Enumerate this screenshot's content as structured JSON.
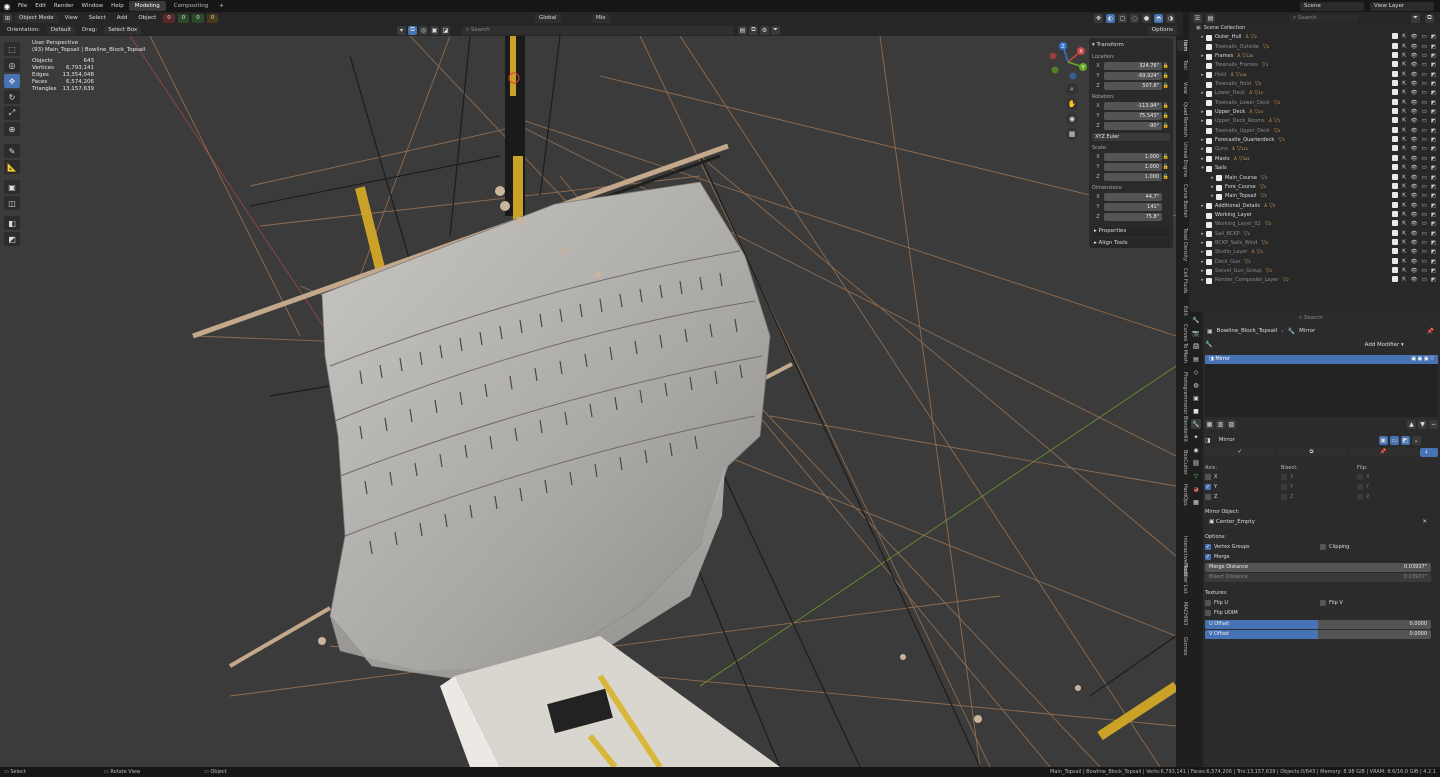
{
  "menu": [
    "File",
    "Edit",
    "Render",
    "Window",
    "Help"
  ],
  "workspaces": [
    "Modeling",
    "Compositing"
  ],
  "scene": {
    "label": "Scene",
    "view_layer": "View Layer"
  },
  "header": {
    "mode": "Object Mode",
    "menus": [
      "View",
      "Select",
      "Add",
      "Object"
    ],
    "counters": [
      "0",
      "0",
      "0",
      "0"
    ],
    "orientation_label": "Orientation:",
    "orientation": "Default",
    "drag_label": "Drag:",
    "drag": "Select Box",
    "transform_orientation": "Global",
    "pivot": "Mix",
    "search_placeholder": "Search",
    "options": "Options"
  },
  "overlay": {
    "view": "User Perspective",
    "context": "(93) Main_Topsail | Bowline_Block_Topsail",
    "stats": [
      {
        "k": "Objects",
        "v": "643"
      },
      {
        "k": "Vertices",
        "v": "6,793,141"
      },
      {
        "k": "Edges",
        "v": "13,354,048"
      },
      {
        "k": "Faces",
        "v": "6,574,206"
      },
      {
        "k": "Triangles",
        "v": "13,157,639"
      }
    ]
  },
  "gizmo": {
    "x": "X",
    "y": "Y",
    "z": "Z"
  },
  "npanel": {
    "title": "Transform",
    "location_label": "Location:",
    "location": [
      {
        "a": "X",
        "v": "324.76\""
      },
      {
        "a": "Y",
        "v": "-69.924\""
      },
      {
        "a": "Z",
        "v": "507.8\""
      }
    ],
    "rotation_label": "Rotation:",
    "rotation": [
      {
        "a": "X",
        "v": "-113.94°"
      },
      {
        "a": "Y",
        "v": "75.543°"
      },
      {
        "a": "Z",
        "v": "-90°"
      }
    ],
    "rotation_mode": "XYZ Euler",
    "scale_label": "Scale:",
    "scale": [
      {
        "a": "X",
        "v": "1.000"
      },
      {
        "a": "Y",
        "v": "1.000"
      },
      {
        "a": "Z",
        "v": "1.000"
      }
    ],
    "dimensions_label": "Dimensions:",
    "dimensions": [
      {
        "a": "X",
        "v": "44.7\""
      },
      {
        "a": "Y",
        "v": "141\""
      },
      {
        "a": "Z",
        "v": "75.8\""
      }
    ],
    "properties": "Properties",
    "align_tools": "Align Tools"
  },
  "side_tabs": [
    "Item",
    "Tool",
    "View",
    "Quad Remesh",
    "Unreal Engine",
    "Curve Basher",
    "Texel Density",
    "Cell Fluids",
    "Edit",
    "Curves To Mesh",
    "Photogrammetor",
    "BlenderKit",
    "BoxCutter",
    "HardOps",
    "Interactive Tools",
    "Modifier List",
    "MACHIN3",
    "Gizmos"
  ],
  "outliner": {
    "search": "Search",
    "root": "Scene Collection",
    "items": [
      {
        "name": "Outer_Hull",
        "mods": "⅄ ▽₂",
        "dim": false,
        "tri": "▸",
        "indent": 0
      },
      {
        "name": "Treenails_Outside",
        "mods": "▽₂",
        "dim": true,
        "tri": "",
        "indent": 0
      },
      {
        "name": "Frames",
        "mods": "⅄ ▽₁₂₆",
        "dim": false,
        "tri": "▸",
        "indent": 0
      },
      {
        "name": "Treenails_Frames",
        "mods": "▽₂",
        "dim": true,
        "tri": "",
        "indent": 0
      },
      {
        "name": "Hold",
        "mods": "⅄ ▽₁₁₆",
        "dim": true,
        "tri": "▸",
        "indent": 0
      },
      {
        "name": "Treenails_Hold",
        "mods": "▽₂",
        "dim": true,
        "tri": "",
        "indent": 0
      },
      {
        "name": "Lower_Deck",
        "mods": "⅄ ▽₁₀",
        "dim": true,
        "tri": "▸",
        "indent": 0
      },
      {
        "name": "Treenails_Lower_Deck",
        "mods": "▽₂",
        "dim": true,
        "tri": "",
        "indent": 0
      },
      {
        "name": "Upper_Deck",
        "mods": "⅄ ▽₂₄",
        "dim": false,
        "tri": "▸",
        "indent": 0
      },
      {
        "name": "Upper_Deck_Rooms",
        "mods": "⅄ ▽₂",
        "dim": true,
        "tri": "▸",
        "indent": 0
      },
      {
        "name": "Treenails_Upper_Deck",
        "mods": "▽₂",
        "dim": true,
        "tri": "",
        "indent": 0
      },
      {
        "name": "Forecastle_Quarterdeck",
        "mods": "▽₂",
        "dim": false,
        "tri": "▸",
        "indent": 0
      },
      {
        "name": "Guns",
        "mods": "⅄ ▽₁₁₂",
        "dim": true,
        "tri": "▸",
        "indent": 0
      },
      {
        "name": "Masts",
        "mods": "⅄ ▽₃₂₂",
        "dim": false,
        "tri": "▸",
        "indent": 0
      },
      {
        "name": "Sails",
        "mods": "",
        "dim": false,
        "tri": "▾",
        "indent": 0
      },
      {
        "name": "Main_Course",
        "mods": "▽₂",
        "dim": false,
        "tri": "▸",
        "indent": 1
      },
      {
        "name": "Fore_Course",
        "mods": "▽₂",
        "dim": false,
        "tri": "▸",
        "indent": 1
      },
      {
        "name": "Main_Topsail",
        "mods": "▽₂",
        "dim": false,
        "tri": "▸",
        "indent": 1
      },
      {
        "name": "Additional_Details",
        "mods": "⅄ ▽₂",
        "dim": false,
        "tri": "▸",
        "indent": 0
      },
      {
        "name": "Working_Layer",
        "mods": "",
        "dim": false,
        "tri": "",
        "indent": 0
      },
      {
        "name": "Working_Layer_02",
        "mods": "▽₂",
        "dim": true,
        "tri": "",
        "indent": 0
      },
      {
        "name": "Sail_BCKP",
        "mods": "▽₂",
        "dim": true,
        "tri": "▸",
        "indent": 0
      },
      {
        "name": "BCKP_Sails_Wind",
        "mods": "▽₈",
        "dim": true,
        "tri": "▸",
        "indent": 0
      },
      {
        "name": "Studio_Layer",
        "mods": "⅄ ▽₂",
        "dim": true,
        "tri": "▸",
        "indent": 0
      },
      {
        "name": "Deck_Gun",
        "mods": "▽₂",
        "dim": true,
        "tri": "▸",
        "indent": 0
      },
      {
        "name": "Swivel_Gun_Group",
        "mods": "▽₂",
        "dim": true,
        "tri": "▸",
        "indent": 0
      },
      {
        "name": "Render_Composite_Layer",
        "mods": "▽₂",
        "dim": true,
        "tri": "▸",
        "indent": 0
      }
    ]
  },
  "properties": {
    "search": "Search",
    "object": "Bowline_Block_Topsail",
    "modifier": "Mirror",
    "add_modifier": "Add Modifier",
    "stack_item": "Mirror",
    "name_field": "Mirror",
    "axis_label": "Axis:",
    "bisect_label": "Bisect:",
    "flip_label": "Flip:",
    "axes": [
      {
        "a": "X",
        "axis": false
      },
      {
        "a": "Y",
        "axis": true
      },
      {
        "a": "Z",
        "axis": false
      }
    ],
    "mirror_object_label": "Mirror Object:",
    "mirror_object": "Center_Empty",
    "options_label": "Options:",
    "vertex_groups": "Vertex Groups",
    "clipping": "Clipping",
    "merge": "Merge",
    "merge_distance_label": "Merge Distance",
    "merge_distance": "0.03937\"",
    "bisect_distance_label": "Bisect Distance",
    "bisect_distance": "0.03937\"",
    "textures_label": "Textures:",
    "flip_u": "Flip U",
    "flip_v": "Flip V",
    "flip_udim": "Flip UDIM",
    "u_offset_label": "U Offset",
    "u_offset": "0.0000",
    "v_offset_label": "V Offset",
    "v_offset": "0.0000"
  },
  "status": {
    "select": "Select",
    "rotate": "Rotate View",
    "object": "Object",
    "info": "Main_Topsail | Bowline_Block_Topsail | Verts:6,793,141 | Faces:6,574,206 | Tris:13,157,639 | Objects:0/643 | Memory: 8.98 GiB | VRAM: 8.6/16.0 GiB | 4.2.1"
  },
  "colors": {
    "accent": "#4772b3",
    "viewport": "#3b3b3b",
    "sail": "#b8b6b2",
    "rope": "#a77a56"
  }
}
